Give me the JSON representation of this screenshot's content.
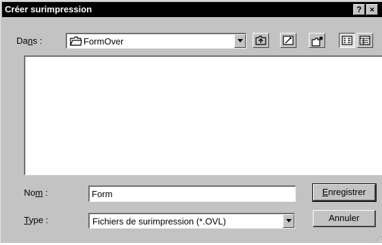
{
  "window": {
    "title": "Créer surimpression",
    "help_glyph": "?",
    "close_glyph": "×"
  },
  "location": {
    "label_pre": "Da",
    "label_key": "n",
    "label_post": "s :",
    "current_folder": "FormOver"
  },
  "filename": {
    "label_pre": "No",
    "label_key": "m",
    "label_post": " :",
    "value": "Form"
  },
  "filetype": {
    "label_key": "T",
    "label_post": "ype :",
    "selected": "Fichiers de surimpression (*.OVL)"
  },
  "buttons": {
    "save_key": "E",
    "save_rest": "nregistrer",
    "cancel": "Annuler"
  }
}
